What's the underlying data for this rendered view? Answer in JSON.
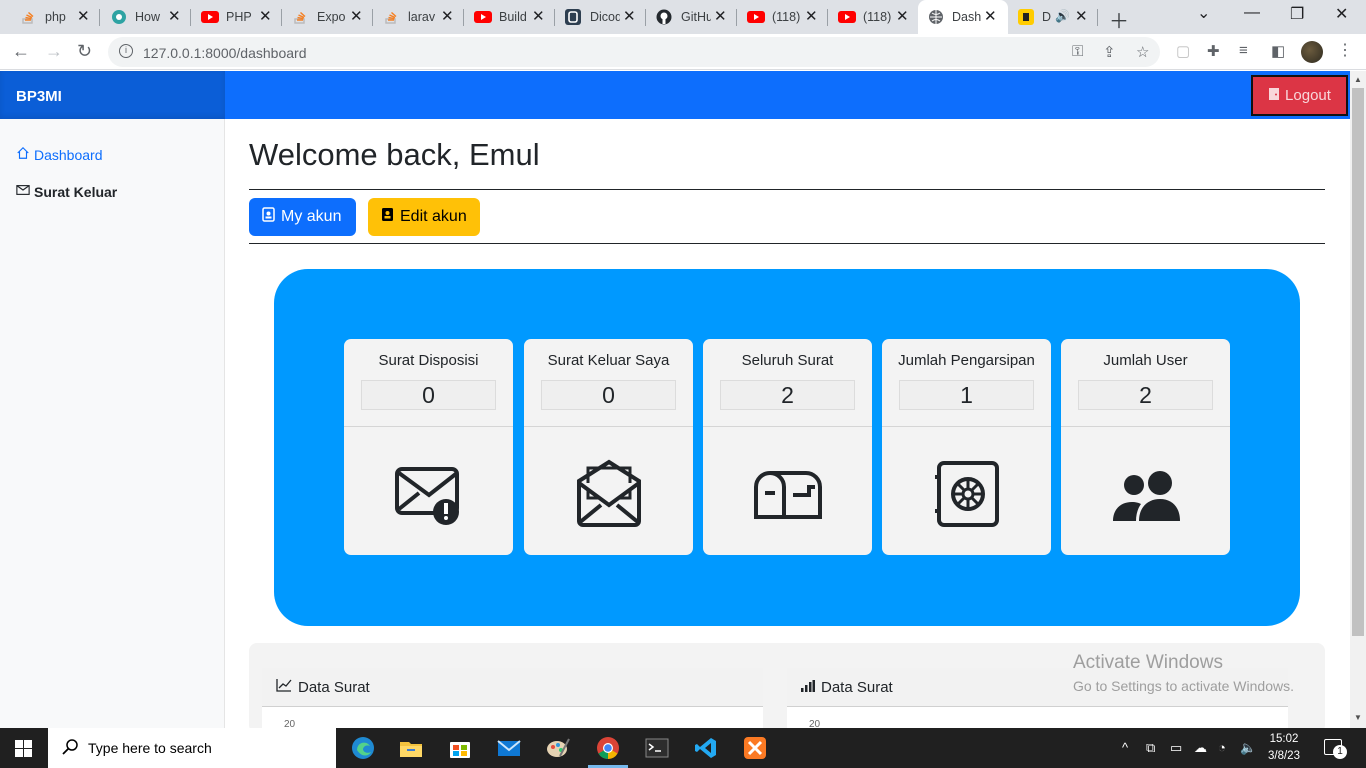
{
  "browser": {
    "tabs": [
      {
        "title": "php",
        "icon": "stackoverflow-icon",
        "color": "#f48024"
      },
      {
        "title": "How",
        "icon": "hashnode-icon",
        "color": "#2ea3a3"
      },
      {
        "title": "PHP",
        "icon": "youtube-icon",
        "color": "#ff0000"
      },
      {
        "title": "Expo",
        "icon": "stackoverflow-icon",
        "color": "#f48024"
      },
      {
        "title": "larav",
        "icon": "stackoverflow-icon",
        "color": "#f48024"
      },
      {
        "title": "Build",
        "icon": "youtube-icon",
        "color": "#ff0000"
      },
      {
        "title": "Dicod",
        "icon": "dicoding-icon",
        "color": "#2d3e50"
      },
      {
        "title": "GitHu",
        "icon": "github-icon",
        "color": "#24292e"
      },
      {
        "title": "(118)",
        "icon": "youtube-icon",
        "color": "#ff0000"
      },
      {
        "title": "(118)",
        "icon": "youtube-icon",
        "color": "#ff0000"
      },
      {
        "title": "Dash",
        "icon": "globe-icon",
        "color": "#5f6368"
      },
      {
        "title": "D",
        "icon": "audio-tab-icon",
        "color": "#ffcc00"
      }
    ],
    "url": "127.0.0.1:8000/dashboard"
  },
  "navbar": {
    "brand": "BP3MI",
    "logout_label": "Logout"
  },
  "sidebar": {
    "items": [
      {
        "label": "Dashboard",
        "icon": "house-icon",
        "active": true
      },
      {
        "label": "Surat Keluar",
        "icon": "envelope-icon",
        "active": false
      }
    ]
  },
  "main": {
    "welcome": "Welcome back, Emul",
    "buttons": {
      "my_akun": "My akun",
      "edit_akun": "Edit akun"
    },
    "stats": [
      {
        "title": "Surat Disposisi",
        "value": "0",
        "icon": "envelope-exclamation-icon"
      },
      {
        "title": "Surat Keluar Saya",
        "value": "0",
        "icon": "envelope-open-icon"
      },
      {
        "title": "Seluruh Surat",
        "value": "2",
        "icon": "mailbox-icon"
      },
      {
        "title": "Jumlah Pengarsipan",
        "value": "1",
        "icon": "safe-icon"
      },
      {
        "title": "Jumlah User",
        "value": "2",
        "icon": "people-icon"
      }
    ],
    "charts": [
      {
        "title": "Data Surat",
        "icon": "graph-up-icon",
        "first_tick": "20"
      },
      {
        "title": "Data Surat",
        "icon": "bar-chart-icon",
        "first_tick": "20"
      }
    ]
  },
  "watermark": {
    "line1": "Activate Windows",
    "line2": "Go to Settings to activate Windows."
  },
  "taskbar": {
    "search_placeholder": "Type here to search",
    "time": "15:02",
    "date": "3/8/23",
    "notification_count": "1"
  },
  "colors": {
    "primary": "#0d6efd",
    "warning": "#ffc107",
    "danger": "#dc3545",
    "panel": "#0099ff"
  }
}
